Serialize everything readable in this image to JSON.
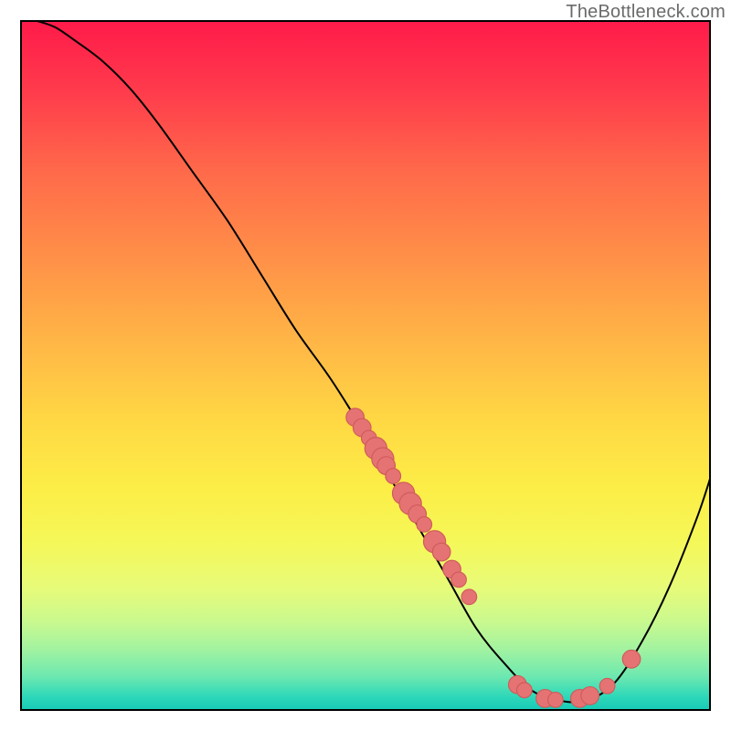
{
  "watermark": "TheBottleneck.com",
  "colors": {
    "curve_stroke": "#000000",
    "point_fill": "#e57373",
    "point_stroke": "#cf5a5a"
  },
  "chart_data": {
    "type": "line",
    "title": "",
    "xlabel": "",
    "ylabel": "",
    "xlim": [
      0,
      100
    ],
    "ylim": [
      0,
      100
    ],
    "grid": false,
    "legend": false,
    "series": [
      {
        "name": "bottleneck-curve",
        "note": "Smooth V-shaped curve starting upper-left, dipping to a flat trough around x≈72–82, then rising toward upper-right. Values estimated from pixel positions; axes are unlabeled so units are 0–100 normalized.",
        "x": [
          2,
          5,
          8,
          12,
          16,
          20,
          25,
          30,
          35,
          40,
          45,
          50,
          54,
          58,
          62,
          66,
          70,
          74,
          78,
          82,
          86,
          90,
          94,
          98,
          100
        ],
        "y": [
          100,
          99,
          97,
          94,
          90,
          85,
          78,
          71,
          63,
          55,
          48,
          40,
          33,
          26,
          19,
          12,
          7,
          3,
          1.5,
          1.5,
          4,
          10,
          18,
          28,
          34
        ]
      }
    ],
    "scatter_points": {
      "name": "highlighted-points",
      "note": "Salmon-colored dots drawn along the curve; grouped as a mid-slope cluster and a trough cluster. Sizes in approximate radius units (0–100 scale).",
      "points": [
        {
          "x": 48.5,
          "y": 42.5,
          "r": 1.3
        },
        {
          "x": 49.5,
          "y": 41.0,
          "r": 1.3
        },
        {
          "x": 50.5,
          "y": 39.5,
          "r": 1.1
        },
        {
          "x": 51.5,
          "y": 38.0,
          "r": 1.6
        },
        {
          "x": 52.5,
          "y": 36.5,
          "r": 1.6
        },
        {
          "x": 53.0,
          "y": 35.5,
          "r": 1.3
        },
        {
          "x": 54.0,
          "y": 34.0,
          "r": 1.1
        },
        {
          "x": 55.5,
          "y": 31.5,
          "r": 1.6
        },
        {
          "x": 56.5,
          "y": 30.0,
          "r": 1.6
        },
        {
          "x": 57.5,
          "y": 28.5,
          "r": 1.3
        },
        {
          "x": 58.5,
          "y": 27.0,
          "r": 1.1
        },
        {
          "x": 60.0,
          "y": 24.5,
          "r": 1.6
        },
        {
          "x": 61.0,
          "y": 23.0,
          "r": 1.3
        },
        {
          "x": 62.5,
          "y": 20.5,
          "r": 1.3
        },
        {
          "x": 63.5,
          "y": 19.0,
          "r": 1.1
        },
        {
          "x": 65.0,
          "y": 16.5,
          "r": 1.1
        },
        {
          "x": 72.0,
          "y": 3.8,
          "r": 1.3
        },
        {
          "x": 73.0,
          "y": 3.0,
          "r": 1.1
        },
        {
          "x": 76.0,
          "y": 1.8,
          "r": 1.3
        },
        {
          "x": 77.5,
          "y": 1.6,
          "r": 1.1
        },
        {
          "x": 81.0,
          "y": 1.8,
          "r": 1.3
        },
        {
          "x": 82.5,
          "y": 2.2,
          "r": 1.3
        },
        {
          "x": 85.0,
          "y": 3.6,
          "r": 1.1
        },
        {
          "x": 88.5,
          "y": 7.5,
          "r": 1.3
        }
      ]
    }
  }
}
